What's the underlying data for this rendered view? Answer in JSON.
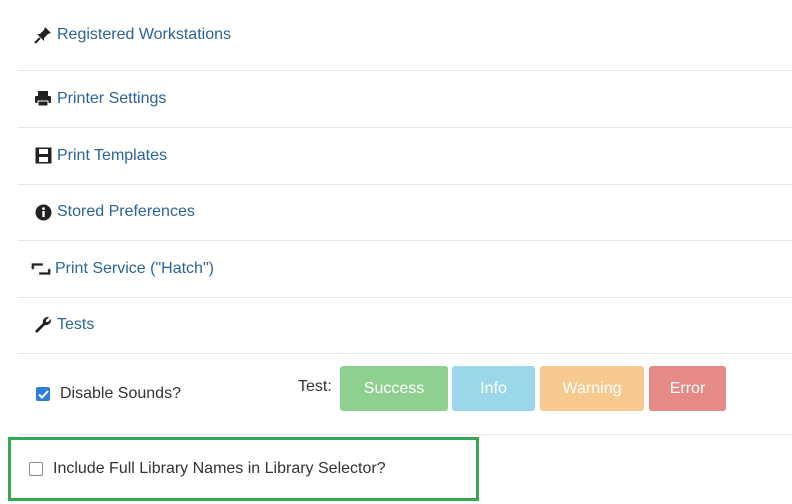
{
  "menu": {
    "items": [
      {
        "label": "Registered Workstations",
        "icon": "pushpin-icon"
      },
      {
        "label": "Printer Settings",
        "icon": "printer-icon"
      },
      {
        "label": "Print Templates",
        "icon": "film-icon"
      },
      {
        "label": "Stored Preferences",
        "icon": "info-circle-icon"
      },
      {
        "label": "Print Service (\"Hatch\")",
        "icon": "retweet-icon"
      },
      {
        "label": "Tests",
        "icon": "wrench-icon"
      }
    ]
  },
  "sounds": {
    "checkbox_label": "Disable Sounds?",
    "checked": true,
    "test_label": "Test:",
    "buttons": {
      "success": "Success",
      "info": "Info",
      "warning": "Warning",
      "error": "Error"
    }
  },
  "library_names": {
    "checkbox_label": "Include Full Library Names in Library Selector?",
    "checked": false
  },
  "colors": {
    "link": "#2a6496",
    "success": "#8fcf8f",
    "info": "#9ad7ea",
    "warning": "#f6c98e",
    "error": "#e58a86",
    "highlight": "#35a853",
    "checkbox_checked": "#2f7de1"
  }
}
